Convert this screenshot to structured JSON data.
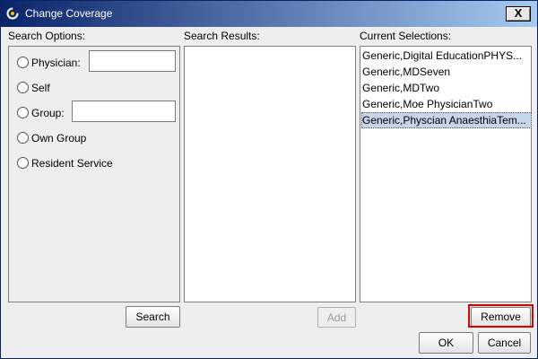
{
  "window": {
    "title": "Change Coverage",
    "close_label": "X"
  },
  "search_options": {
    "label": "Search Options:",
    "physician_label": "Physician:",
    "physician_value": "",
    "self_label": "Self",
    "group_label": "Group:",
    "group_value": "",
    "own_group_label": "Own Group",
    "resident_service_label": "Resident Service",
    "search_button": "Search"
  },
  "search_results": {
    "label": "Search Results:",
    "items": [],
    "add_button": "Add"
  },
  "current_selections": {
    "label": "Current Selections:",
    "items": [
      "Generic,Digital EducationPHYS...",
      "Generic,MDSeven",
      "Generic,MDTwo",
      "Generic,Moe PhysicianTwo",
      "Generic,Physcian AnaesthiaTem..."
    ],
    "selected_index": 4,
    "remove_button": "Remove"
  },
  "footer": {
    "ok_button": "OK",
    "cancel_button": "Cancel"
  },
  "colors": {
    "title_bar": "#0a246a",
    "selection": "#c6d5e8",
    "highlight": "#e00000"
  }
}
